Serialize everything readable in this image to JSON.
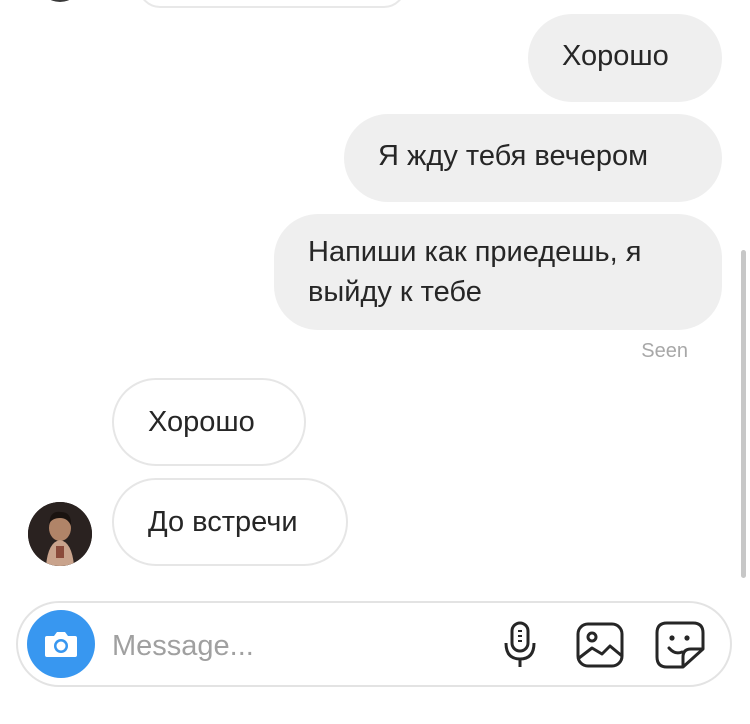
{
  "messages": [
    {
      "direction": "outgoing",
      "text": "Хорошо"
    },
    {
      "direction": "outgoing",
      "text": "Я жду тебя вечером"
    },
    {
      "direction": "outgoing",
      "lines": [
        "Напиши как приедешь, я",
        "выйду к тебе"
      ]
    },
    {
      "direction": "incoming",
      "text": "Хорошо"
    },
    {
      "direction": "incoming",
      "text": "До встречи"
    }
  ],
  "status": {
    "seen": "Seen"
  },
  "composer": {
    "placeholder": "Message..."
  },
  "icons": {
    "camera": "camera-icon",
    "microphone": "microphone-icon",
    "gallery": "gallery-icon",
    "sticker": "sticker-icon"
  },
  "colors": {
    "outgoing_bubble": "#efefef",
    "incoming_border": "#e6e6e6",
    "accent": "#3897f0",
    "text": "#262626",
    "muted": "#a8a8a8"
  }
}
